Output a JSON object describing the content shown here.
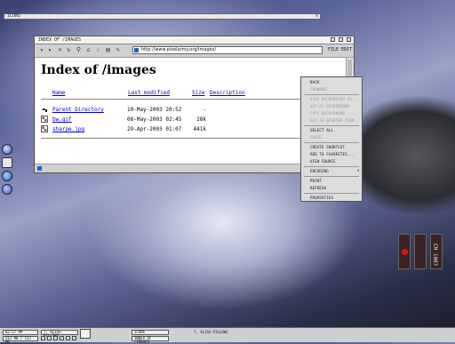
{
  "top_bar": {
    "label": "ICONS",
    "close": "x"
  },
  "browser": {
    "title": "INDEX OF /IMAGES",
    "address": "http://www.pixelarmy.org/images/",
    "toolbar": {
      "file": "FILE",
      "edit": "EDIT"
    },
    "page": {
      "heading": "Index of /images",
      "columns": [
        "Name",
        "Last modified",
        "Size",
        "Description"
      ],
      "rows": [
        {
          "name": "Parent Directory",
          "modified": "10-May-2003 20:52",
          "size": "-"
        },
        {
          "name": "bw.gif",
          "modified": "08-May-2003 02:45",
          "size": "28k"
        },
        {
          "name": "sharpe.jpg",
          "modified": "29-Apr-2003 01:07",
          "size": "441k"
        }
      ]
    }
  },
  "context_menu": {
    "items": [
      {
        "label": "BACK",
        "enabled": true
      },
      {
        "label": "FORWARD",
        "enabled": false
      },
      {
        "label": "SAVE BACKGROUND AS...",
        "enabled": false
      },
      {
        "label": "SET AS BACKGROUND",
        "enabled": false
      },
      {
        "label": "COPY BACKGROUND",
        "enabled": false
      },
      {
        "label": "SET AS DESKTOP ITEM...",
        "enabled": false
      },
      {
        "label": "SELECT ALL",
        "enabled": true
      },
      {
        "label": "PASTE",
        "enabled": false
      },
      {
        "label": "CREATE SHORTCUT",
        "enabled": true
      },
      {
        "label": "ADD TO FAVORITES...",
        "enabled": true
      },
      {
        "label": "VIEW SOURCE",
        "enabled": true
      },
      {
        "label": "ENCODING",
        "enabled": true
      },
      {
        "label": "PRINT",
        "enabled": true
      },
      {
        "label": "REFRESH",
        "enabled": true
      },
      {
        "label": "PROPERTIES",
        "enabled": true
      }
    ]
  },
  "taskbar": {
    "clock": "02:17 PM",
    "mem": "512 MB / 512 MB",
    "tasks": [
      "ICONS",
      "INDEX OF /IMAGES"
    ],
    "user": "7. ALIAS-PILLOWS"
  },
  "panels": {
    "text": "CM 1007"
  },
  "colors": {
    "accent": "#1e5fc8",
    "link": "#0000cc"
  }
}
